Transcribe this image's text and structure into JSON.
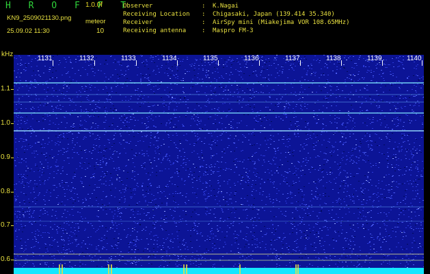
{
  "header": {
    "title": "H R O F F T",
    "version": "1.0.0f",
    "filename": "KN9_2509021130.png",
    "meteor_label": "meteor",
    "datetime": "25.09.02 11:30",
    "meteor_count": "10"
  },
  "station_info": [
    {
      "key": "Observer",
      "sep": ":",
      "value": "K.Nagai"
    },
    {
      "key": "Receiving Location",
      "sep": ":",
      "value": "Chigasaki, Japan (139.414 35.340)"
    },
    {
      "key": "Receiver",
      "sep": ":",
      "value": "AirSpy mini (Miakejima VOR 108.65MHz)"
    },
    {
      "key": "Receiving antenna",
      "sep": ":",
      "value": "Maspro FM-3"
    }
  ],
  "y_axis": {
    "unit": "kHz",
    "ticks": [
      "1.1",
      "1.0",
      "0.9",
      "0.8",
      "0.7",
      "0.6"
    ]
  },
  "x_axis": {
    "ticks": [
      "1131",
      "1132",
      "1133",
      "1134",
      "1135",
      "1136",
      "1137",
      "1138",
      "1139",
      "1140"
    ]
  },
  "colors": {
    "background": "#000000",
    "waterfall": "#0c1496",
    "header_text": "#e8e040",
    "title_text": "#2fd23a",
    "signal_line": "#7fe6ff",
    "baseline": "#14e6ff"
  }
}
